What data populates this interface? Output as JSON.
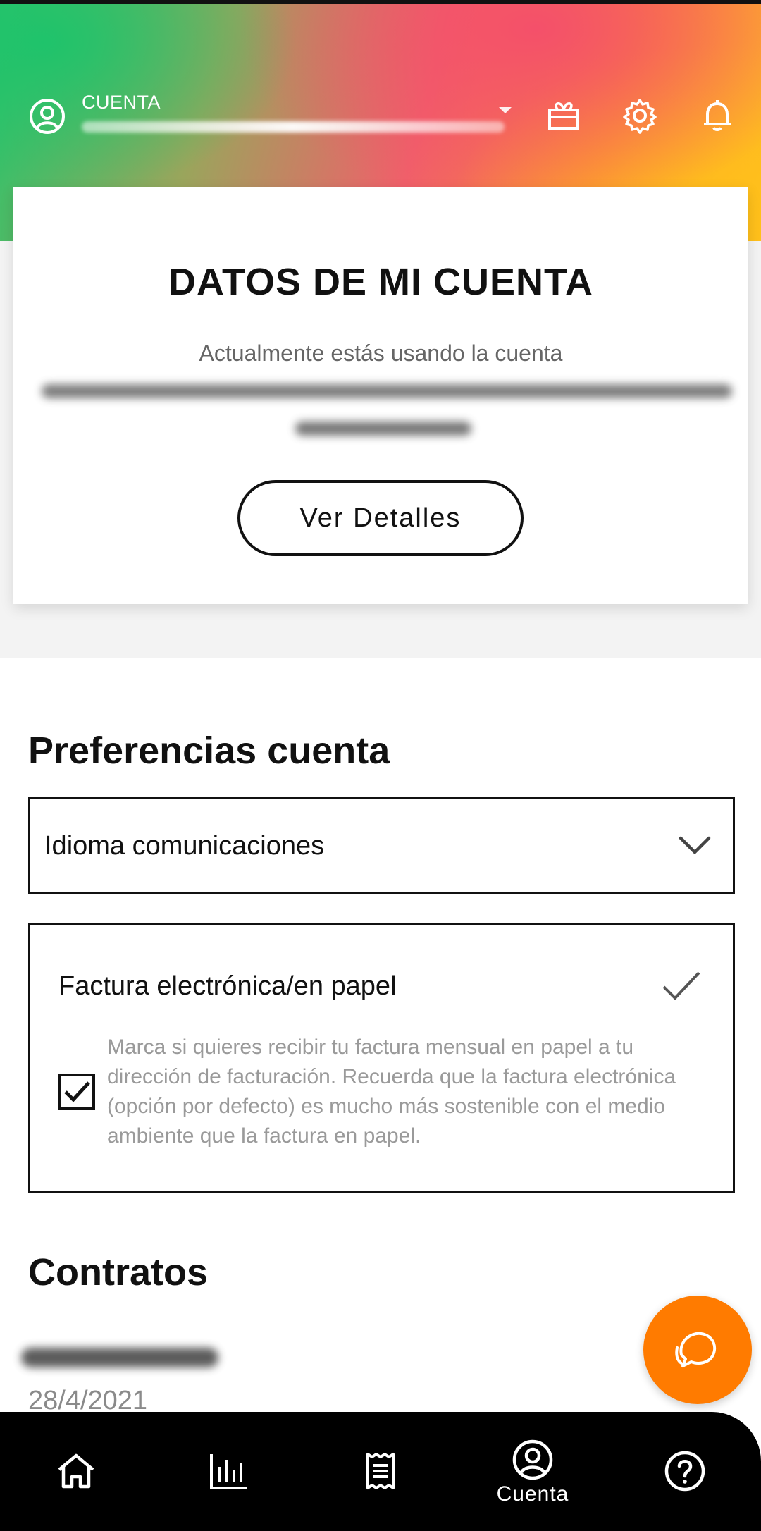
{
  "header": {
    "account_label": "CUENTA",
    "icons": [
      "gift-icon",
      "gear-icon",
      "bell-icon"
    ]
  },
  "account_card": {
    "title": "DATOS DE MI CUENTA",
    "subtitle": "Actualmente estás usando la cuenta",
    "details_button": "Ver Detalles"
  },
  "preferences": {
    "title": "Preferencias cuenta",
    "language_select": "Idioma comunicaciones",
    "invoice": {
      "title": "Factura electrónica/en papel",
      "checked": true,
      "description": "Marca si quieres recibir tu factura mensual en papel a tu dirección de facturación. Recuerda que la factura electrónica (opción por defecto) es mucho más sostenible con el medio ambiente que la factura en papel."
    }
  },
  "contracts": {
    "title": "Contratos",
    "items": [
      {
        "date": "28/4/2021"
      }
    ]
  },
  "fab": {
    "icon": "chat-icon"
  },
  "bottom_nav": {
    "items": [
      {
        "icon": "home-icon",
        "label": ""
      },
      {
        "icon": "chart-icon",
        "label": ""
      },
      {
        "icon": "invoice-icon",
        "label": ""
      },
      {
        "icon": "account-icon",
        "label": "Cuenta",
        "active": true
      },
      {
        "icon": "help-icon",
        "label": ""
      }
    ]
  },
  "colors": {
    "accent": "#ff7b00",
    "nav_background": "#000000",
    "header_gradient": [
      "#2cc46b",
      "#f0606a",
      "#fb8838",
      "#ffc022"
    ]
  }
}
